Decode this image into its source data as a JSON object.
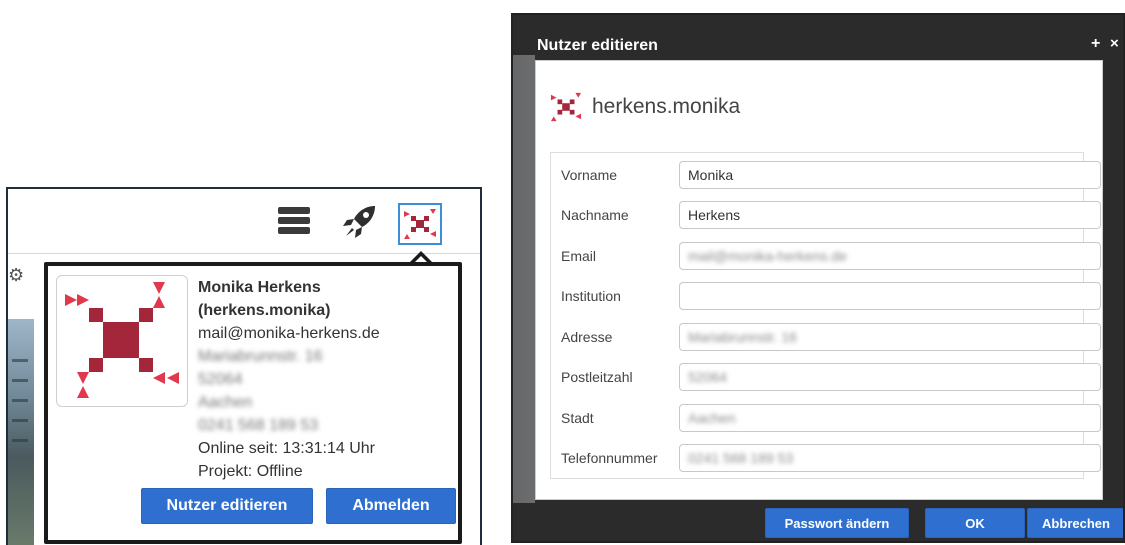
{
  "popover": {
    "name_line1": "Monika Herkens",
    "name_line2": "(herkens.monika)",
    "email": "mail@monika-herkens.de",
    "street": "Mariabrunnstr. 16",
    "zip": "52064",
    "city": "Aachen",
    "phone": "0241 568 189 53",
    "online_since": "Online seit: 13:31:14 Uhr",
    "project": "Projekt: Offline",
    "edit_button": "Nutzer editieren",
    "logout_button": "Abmelden"
  },
  "dialog": {
    "title": "Nutzer editieren",
    "plus": "+",
    "close": "×",
    "username": "herkens.monika",
    "fields": [
      {
        "label": "Vorname",
        "value": "Monika"
      },
      {
        "label": "Nachname",
        "value": "Herkens"
      },
      {
        "label": "Email",
        "value": "mail@monika-herkens.de"
      },
      {
        "label": "Institution",
        "value": ""
      },
      {
        "label": "Adresse",
        "value": "Mariabrunnstr. 16"
      },
      {
        "label": "Postleitzahl",
        "value": "52064"
      },
      {
        "label": "Stadt",
        "value": "Aachen"
      },
      {
        "label": "Telefonnummer",
        "value": "0241 568 189 53"
      }
    ],
    "change_password_button": "Passwort ändern",
    "ok_button": "OK",
    "cancel_button": "Abbrechen"
  },
  "icons": {
    "menu": "menu-icon",
    "rocket": "rocket-icon",
    "avatar": "identicon-avatar",
    "settings": "gear-icon"
  },
  "colors": {
    "accent_blue": "#2f6fd0",
    "avatar_red": "#a3263a",
    "avatar_pink": "#e0394e",
    "dialog_dark": "#2b2b2b"
  }
}
